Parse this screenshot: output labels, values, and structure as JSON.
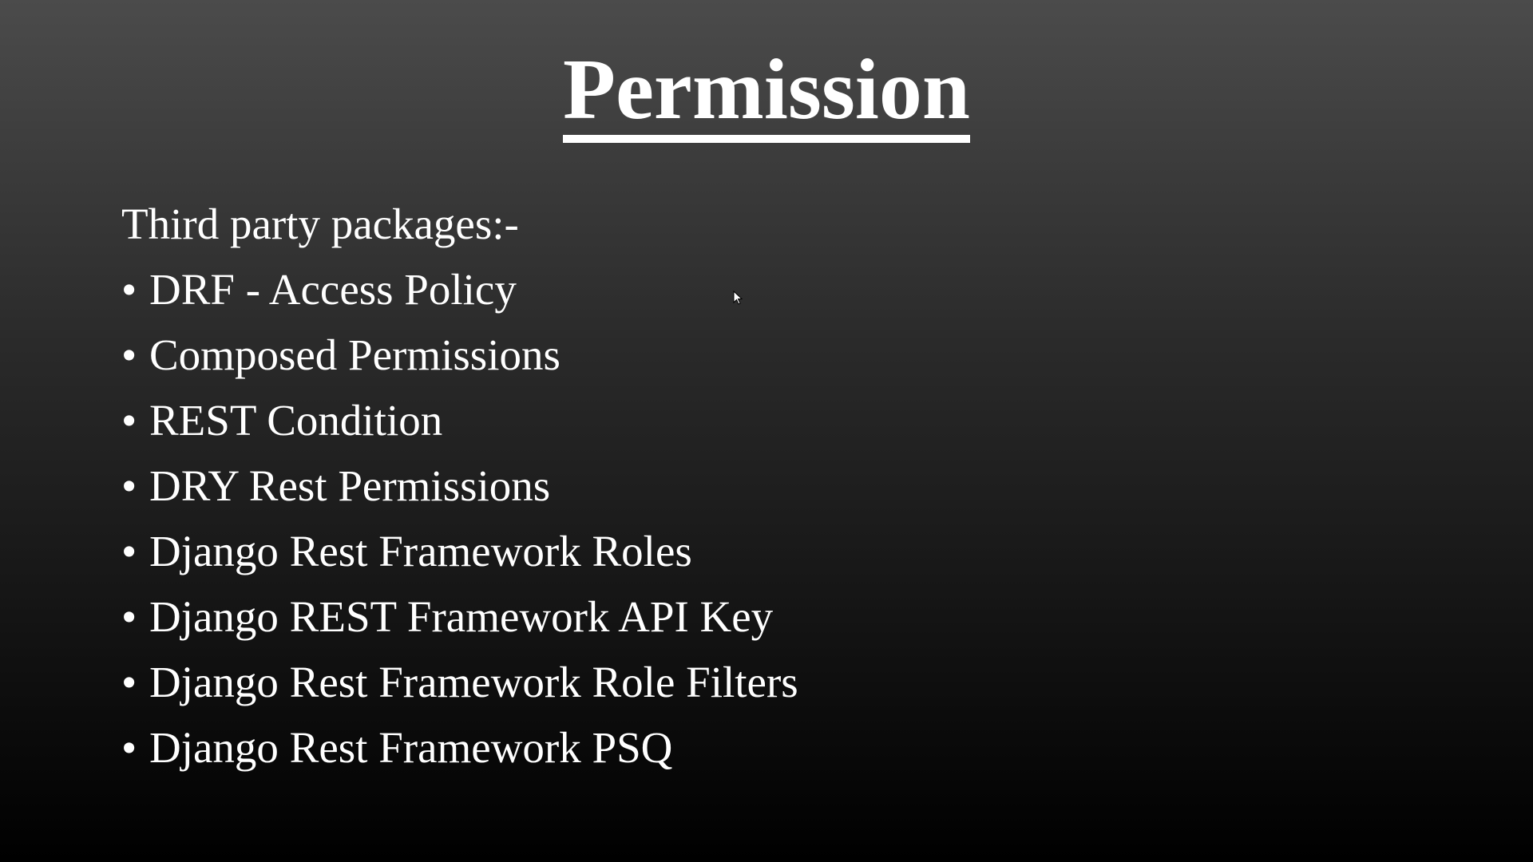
{
  "slide": {
    "title": "Permission",
    "intro": "Third party packages:-",
    "bullet_glyph": "•",
    "items": [
      "DRF - Access Policy",
      "Composed Permissions",
      "REST Condition",
      "DRY Rest Permissions",
      "Django Rest Framework Roles",
      "Django REST Framework API Key",
      "Django Rest Framework Role Filters",
      "Django Rest Framework PSQ"
    ]
  },
  "icons": {
    "cursor": "mouse-pointer-icon"
  }
}
